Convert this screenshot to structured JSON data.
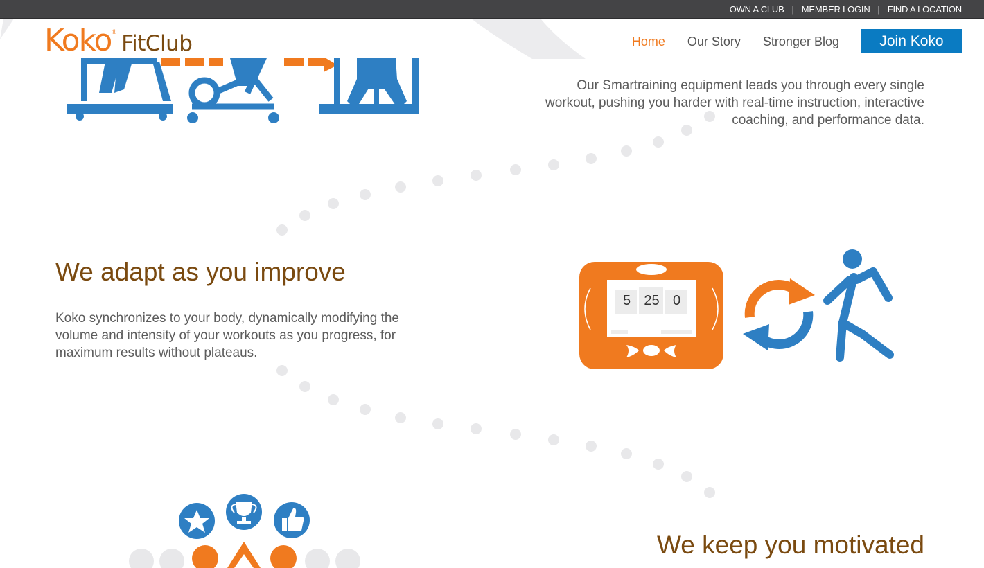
{
  "topbar": {
    "links": [
      "OWN A CLUB",
      "MEMBER LOGIN",
      "FIND A LOCATION"
    ],
    "separator": "|"
  },
  "logo": {
    "primary": "Koko",
    "secondary": "FitClub",
    "mark": "®"
  },
  "nav": {
    "items": [
      "Home",
      "Our Story",
      "Stronger Blog"
    ],
    "active": "Home",
    "join_label": "Join Koko"
  },
  "sections": {
    "smartraining_text": "Our Smartraining equipment leads you through every single workout, pushing you harder with real-time instruction, interactive coaching, and performance data.",
    "adapt_heading": "We adapt as you improve",
    "adapt_text": "Koko synchronizes to your body, dynamically modifying the volume and intensity of your workouts as you progress, for maximum results without plateaus.",
    "motivated_heading": "We keep you motivated"
  },
  "console_readout": [
    "5",
    "25",
    "0"
  ],
  "icons": {
    "equipment": [
      "treadmill-icon",
      "elliptical-icon",
      "strength-machine-icon"
    ],
    "adapt": [
      "koko-console-icon",
      "sync-arrows-icon",
      "walking-person-icon"
    ],
    "motivation": [
      "star-badge-icon",
      "trophy-badge-icon",
      "thumbs-up-badge-icon",
      "people-group-icon"
    ]
  },
  "colors": {
    "brand_orange": "#f07a1f",
    "brand_brown": "#7a4a10",
    "brand_blue": "#0a7bc2",
    "icon_blue": "#2e7fc3",
    "topbar": "#444446",
    "dots": "#e8e8ea"
  }
}
